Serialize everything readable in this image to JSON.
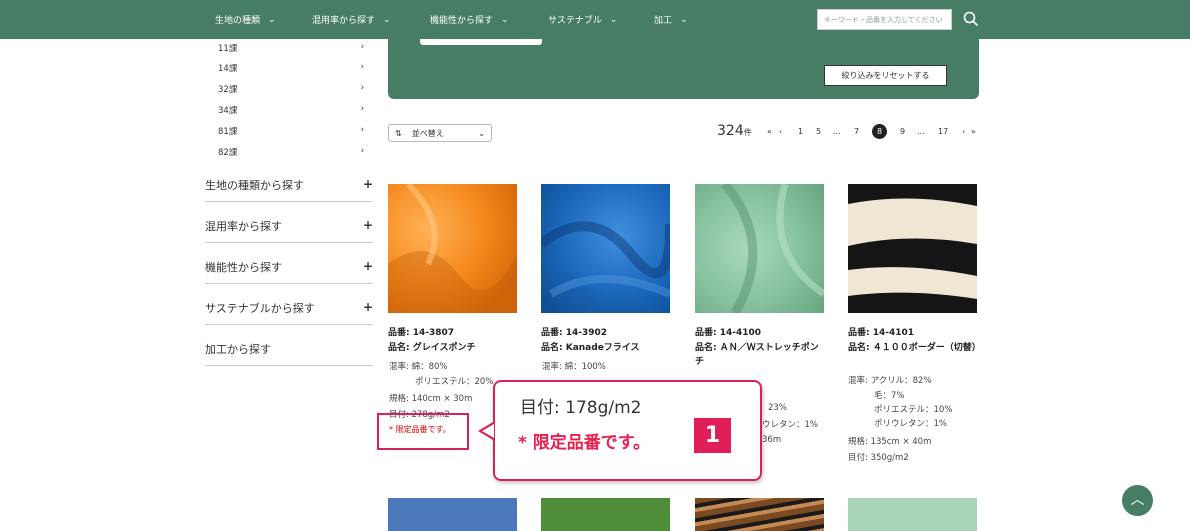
{
  "nav": {
    "items": [
      "生地の種類",
      "混用率から探す",
      "機能性から探す",
      "サステナブル",
      "加工"
    ],
    "search_placeholder": "キーワード・品番を入力してください",
    "bg_color": "#467d64"
  },
  "sidebar": {
    "sub_items": [
      "11課",
      "14課",
      "32課",
      "34課",
      "81課",
      "82課"
    ],
    "categories": [
      "生地の種類から探す",
      "混用率から探す",
      "機能性から探す",
      "サステナブルから探す",
      "加工から探す"
    ]
  },
  "filter": {
    "reset_label": "絞り込みをリセットする"
  },
  "toolbar": {
    "sort_label": "並べ替え",
    "count": "324",
    "count_unit": "件",
    "pages": [
      "1",
      "5",
      "...",
      "7",
      "8",
      "9",
      "...",
      "17"
    ],
    "current_page": "8"
  },
  "products": [
    {
      "code": "品番: 14-3807",
      "name": "品名: グレイスポンチ",
      "specs": [
        "混率: 綿：80%",
        "ポリエステル：20%",
        "規格: 140cm × 30m",
        "目付: 278g/m2"
      ],
      "limited": "* 限定品番です。",
      "color": "#f59331"
    },
    {
      "code": "品番: 14-3902",
      "name": "品名: Kanadeフライス",
      "specs": [
        "混率: 綿：100%"
      ],
      "color": "#1f74c9"
    },
    {
      "code": "品番: 14-4100",
      "name": "品名: ＡＮ／Ｗストレッチポンチ",
      "specs": [
        "23%",
        "ウレタン：1%",
        "36m"
      ],
      "color": "#8cc6a3"
    },
    {
      "code": "品番: 14-4101",
      "name": "品名: ４１００ボーダー（切替）",
      "specs": [
        "混率: アクリル：82%",
        "毛：7%",
        "ポリエステル：10%",
        "ポリウレタン：1%",
        "規格: 135cm × 40m",
        "目付: 350g/m2"
      ],
      "color": "#1a1a1a"
    }
  ],
  "callout": {
    "weight_text": "目付: 178g/m2",
    "limited_text": "* 限定品番です。",
    "number": "1",
    "accent": "#e01f59"
  }
}
